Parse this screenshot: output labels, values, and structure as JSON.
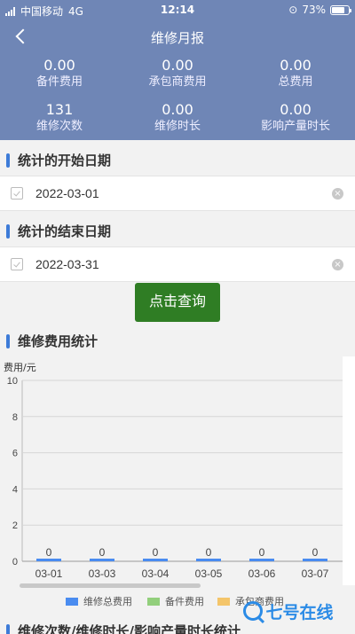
{
  "status_bar": {
    "carrier": "中国移动",
    "network": "4G",
    "time": "12:14",
    "battery": "73%"
  },
  "nav": {
    "title": "维修月报",
    "back_icon": "chevron-left-icon"
  },
  "stats": [
    {
      "value": "0.00",
      "label": "备件费用"
    },
    {
      "value": "0.00",
      "label": "承包商费用"
    },
    {
      "value": "0.00",
      "label": "总费用"
    },
    {
      "value": "131",
      "label": "维修次数"
    },
    {
      "value": "0.00",
      "label": "维修时长"
    },
    {
      "value": "0.00",
      "label": "影响产量时长"
    }
  ],
  "start_section": {
    "title": "统计的开始日期",
    "date": "2022-03-01"
  },
  "end_section": {
    "title": "统计的结束日期",
    "date": "2022-03-31"
  },
  "query_button": "点击查询",
  "cost_section": {
    "title": "维修费用统计"
  },
  "chart_data": {
    "type": "bar",
    "ylabel": "费用/元",
    "ylim": [
      0,
      10
    ],
    "yticks": [
      "0",
      "2",
      "4",
      "6",
      "8",
      "10"
    ],
    "categories": [
      "03-01",
      "03-03",
      "03-04",
      "03-05",
      "03-06",
      "03-07"
    ],
    "series": [
      {
        "name": "维修总费用",
        "values": [
          0,
          0,
          0,
          0,
          0,
          0
        ],
        "color": "#4a8cf0"
      },
      {
        "name": "备件费用",
        "values": [
          0,
          0,
          0,
          0,
          0,
          0
        ],
        "color": "#92cf7c"
      },
      {
        "name": "承包商费用",
        "values": [
          0,
          0,
          0,
          0,
          0,
          0
        ],
        "color": "#f4c56a"
      }
    ],
    "data_labels": [
      "0",
      "0",
      "0",
      "0",
      "0",
      "0"
    ],
    "grid": true,
    "legend_position": "bottom"
  },
  "bottom_section": {
    "title": "维修次数/维修时长/影响产量时长统计"
  },
  "watermark": {
    "text": "七号在线"
  },
  "colors": {
    "header": "#6f86b6",
    "accent": "#3d7bd8",
    "button": "#2f7d24"
  }
}
